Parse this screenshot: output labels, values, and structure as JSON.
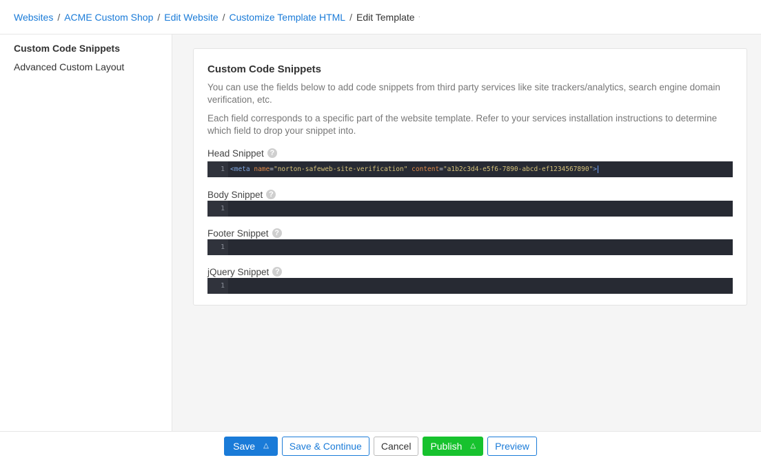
{
  "breadcrumb": {
    "items": [
      "Websites",
      "ACME Custom Shop",
      "Edit Website",
      "Customize Template HTML"
    ],
    "current": "Edit Template"
  },
  "sidebar": {
    "items": [
      {
        "label": "Custom Code Snippets",
        "active": true
      },
      {
        "label": "Advanced Custom Layout",
        "active": false
      }
    ]
  },
  "card": {
    "title": "Custom Code Snippets",
    "desc1": "You can use the fields below to add code snippets from third party services like site trackers/analytics, search engine domain verification, etc.",
    "desc2": "Each field corresponds to a specific part of the website template. Refer to your services installation instructions to determine which field to drop your snippet into."
  },
  "snippets": [
    {
      "label": "Head Snippet",
      "line": "1",
      "code_tag": "<meta",
      "code_attr1": "name",
      "code_val1": "\"norton-safeweb-site-verification\"",
      "code_attr2": "content",
      "code_val2": "\"a1b2c3d4-e5f6-7890-abcd-ef1234567890\"",
      "code_end": ">"
    },
    {
      "label": "Body Snippet",
      "line": "1"
    },
    {
      "label": "Footer Snippet",
      "line": "1"
    },
    {
      "label": "jQuery Snippet",
      "line": "1"
    }
  ],
  "footer": {
    "save": "Save",
    "save_continue": "Save & Continue",
    "cancel": "Cancel",
    "publish": "Publish",
    "preview": "Preview"
  },
  "colors": {
    "link": "#1a7bd8",
    "success": "#17c22e",
    "editor_bg": "#272a33"
  }
}
